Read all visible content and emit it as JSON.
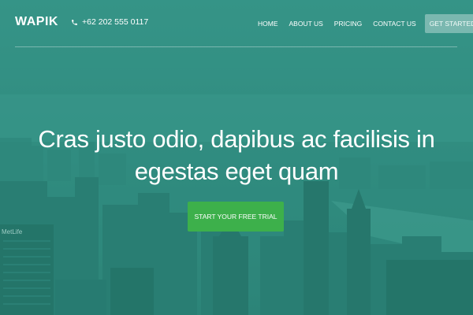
{
  "brand": {
    "logo": "WAPIK"
  },
  "contact": {
    "phone": "+62 202 555 0117",
    "phone_icon": "phone-icon"
  },
  "nav": {
    "items": [
      {
        "label": "HOME"
      },
      {
        "label": "ABOUT US"
      },
      {
        "label": "PRICING"
      },
      {
        "label": "CONTACT US"
      }
    ],
    "cta_label": "GET STARTED"
  },
  "hero": {
    "headline": "Cras justo odio, dapibus ac facilisis in egestas eget quam",
    "button_label": "START YOUR FREE TRIAL",
    "background_image": "city-skyline",
    "sign_text": "MetLife"
  },
  "colors": {
    "overlay": "#2f8a7e",
    "button": "#3db04b",
    "text": "#ffffff"
  }
}
